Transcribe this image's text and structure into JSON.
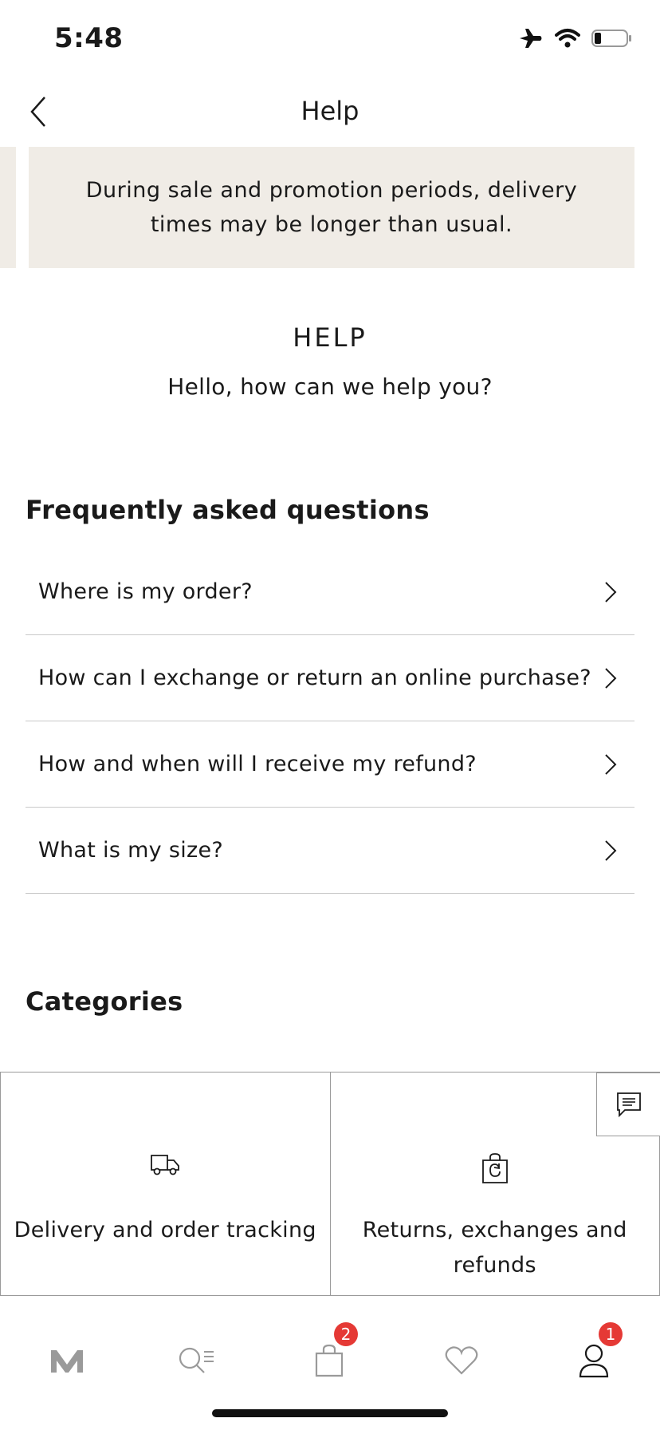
{
  "status_bar": {
    "time": "5:48"
  },
  "nav": {
    "title": "Help"
  },
  "banner": {
    "text": "During sale and promotion periods, delivery times may be longer than usual."
  },
  "help": {
    "heading": "HELP",
    "subtitle": "Hello, how can we help you?"
  },
  "faq": {
    "title": "Frequently asked questions",
    "items": [
      {
        "label": "Where is my order?"
      },
      {
        "label": "How can I exchange or return an online purchase?"
      },
      {
        "label": "How and when will I receive my refund?"
      },
      {
        "label": "What is my size?"
      }
    ]
  },
  "categories": {
    "title": "Categories",
    "items": [
      {
        "label": "Delivery and order tracking",
        "icon": "truck-icon"
      },
      {
        "label": "Returns, exchanges and refunds",
        "icon": "shopping-bag-return-icon"
      }
    ]
  },
  "tabbar": {
    "items": [
      {
        "icon": "brand-logo-icon"
      },
      {
        "icon": "search-menu-icon"
      },
      {
        "icon": "shopping-bag-icon",
        "badge": "2"
      },
      {
        "icon": "heart-icon"
      },
      {
        "icon": "profile-icon",
        "badge": "1"
      }
    ]
  },
  "colors": {
    "banner_bg": "#f0ece6",
    "badge": "#e53935",
    "divider": "#c9c9c9"
  }
}
